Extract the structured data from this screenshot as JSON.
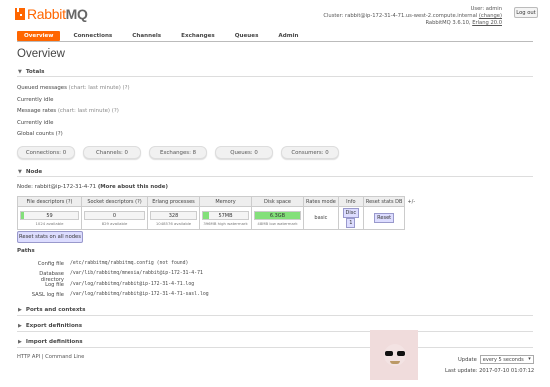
{
  "app": {
    "logo_prefix": "Rabbit",
    "logo_suffix": "MQ"
  },
  "user": {
    "user_line": "User: admin",
    "cluster_line": "Cluster: rabbit@ip-172-31-4-71.us-west-2.compute.internal",
    "change_label": "(change)",
    "version_line": "RabbitMQ 3.6.10,",
    "erlang_label": "Erlang 20.0",
    "logout_label": "Log out"
  },
  "nav": {
    "items": [
      "Overview",
      "Connections",
      "Channels",
      "Exchanges",
      "Queues",
      "Admin"
    ],
    "active": "Overview"
  },
  "page": {
    "title": "Overview"
  },
  "totals": {
    "heading": "Totals",
    "queued_label": "Queued messages",
    "queued_hint": "(chart: last minute) (?)",
    "queued_status": "Currently idle",
    "rates_label": "Message rates",
    "rates_hint": "(chart: last minute) (?)",
    "rates_status": "Currently idle",
    "global_label": "Global counts (?)",
    "counts": [
      {
        "label": "Connections:",
        "value": "0"
      },
      {
        "label": "Channels:",
        "value": "0"
      },
      {
        "label": "Exchanges:",
        "value": "8"
      },
      {
        "label": "Queues:",
        "value": "0"
      },
      {
        "label": "Consumers:",
        "value": "0"
      }
    ]
  },
  "node": {
    "heading": "Node",
    "node_line": "Node: rabbit@ip-172-31-4-71",
    "more_link": "(More about this node)",
    "columns": [
      "File descriptors (?)",
      "Socket descriptors (?)",
      "Erlang processes",
      "Memory",
      "Disk space",
      "Rates mode",
      "Info",
      "Reset stats DB",
      "+/-"
    ],
    "file_desc": {
      "value": "59",
      "sub": "1024 available",
      "fill": 0.058
    },
    "socket_desc": {
      "value": "0",
      "sub": "829 available",
      "fill": 0.0
    },
    "erlang_proc": {
      "value": "328",
      "sub": "1048576 available",
      "fill": 0.0003
    },
    "memory": {
      "value": "57MB",
      "sub": "396MB high watermark",
      "fill": 0.144
    },
    "disk": {
      "value": "6.3GB",
      "sub": "48MB low watermark",
      "fill": 1.0
    },
    "rates_mode": "basic",
    "info_disc": "Disc",
    "info_num": "1",
    "reset_btn": "Reset",
    "reset_all_btn": "Reset stats on all nodes"
  },
  "paths": {
    "heading": "Paths",
    "rows": [
      {
        "key": "Config file",
        "value": "/etc/rabbitmq/rabbitmq.config (not found)"
      },
      {
        "key": "Database directory",
        "value": "/var/lib/rabbitmq/mnesia/rabbit@ip-172-31-4-71"
      },
      {
        "key": "Log file",
        "value": "/var/log/rabbitmq/rabbit@ip-172-31-4-71.log"
      },
      {
        "key": "SASL log file",
        "value": "/var/log/rabbitmq/rabbit@ip-172-31-4-71-sasl.log"
      }
    ]
  },
  "collapsed": [
    "Ports and contexts",
    "Export definitions",
    "Import definitions"
  ],
  "footer": {
    "links": "HTTP API | Command Line",
    "update_label": "Update",
    "update_value": "every 5 seconds",
    "last_update": "Last update: 2017-07-10 01:07:12"
  },
  "colors": {
    "accent": "#ff6600",
    "bar": "#83e07a"
  }
}
